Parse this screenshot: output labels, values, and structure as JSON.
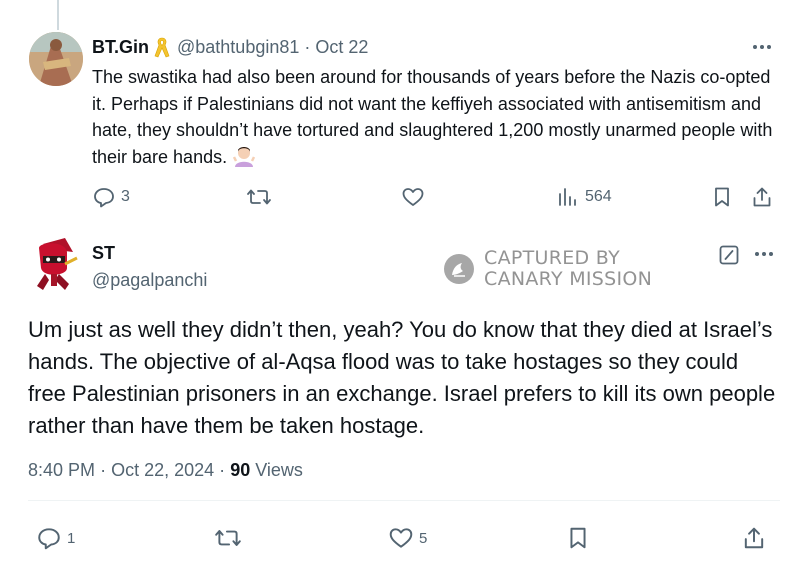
{
  "reply": {
    "name": "BT.Gin",
    "handle": "@bathtubgin81",
    "separator": "·",
    "date": "Oct 22",
    "text": "The swastika had also been around for thousands of years before the Nazis co-opted it. Perhaps if Palestinians did not want the keffiyeh associated with antisemitism and hate, they shouldn’t have tortured and slaughtered 1,200 mostly unarmed people with their bare hands.",
    "actions": {
      "replies": "3",
      "views": "564"
    }
  },
  "main": {
    "name": "ST",
    "handle": "@pagalpanchi",
    "text": "Um just as well they didn’t then, yeah? You do know that they died at Israel’s hands. The objective of al-Aqsa flood was to take hostages so they could free Palestinian prisoners in an exchange. Israel prefers to kill its own people rather than have them be taken hostage.",
    "time": "8:40 PM",
    "separator": "·",
    "date": "Oct 22, 2024",
    "views_count": "90",
    "views_label": "Views",
    "actions": {
      "replies": "1",
      "likes": "5"
    }
  },
  "watermark": {
    "line1": "CAPTURED BY",
    "line2": "CANARY MISSION"
  },
  "icons": {
    "reply": "reply-icon",
    "retweet": "retweet-icon",
    "like": "heart-icon",
    "views": "views-icon",
    "bookmark": "bookmark-icon",
    "share": "share-icon",
    "more": "more-icon",
    "ribbon": "yellow-ribbon-icon",
    "edit": "edit-icon"
  },
  "colors": {
    "text": "#0f1419",
    "secondary": "#536471",
    "ribbon": "#f4c430"
  }
}
